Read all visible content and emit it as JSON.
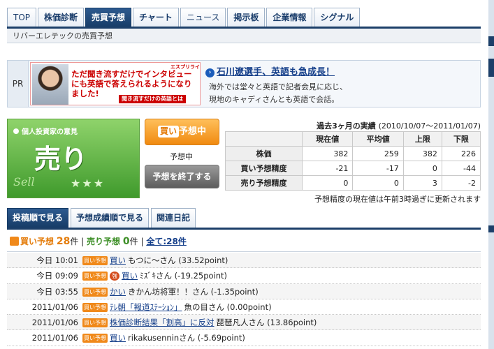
{
  "tabs": [
    {
      "label": "TOP"
    },
    {
      "label": "株価診断"
    },
    {
      "label": "売買予想"
    },
    {
      "label": "チャート"
    },
    {
      "label": "ニュース"
    },
    {
      "label": "掲示板"
    },
    {
      "label": "企業情報"
    },
    {
      "label": "シグナル"
    }
  ],
  "subtitle": "リバーエレテックの売買予想",
  "pr": {
    "label": "PR",
    "ad_brand": "エスプリライン",
    "ad_text": "ただ聞き流すだけでインタビューにも英語で答えられるようになりました!",
    "ad_button": "聞き流すだけの英語とは",
    "headline": "石川遼選手、英語も急成長！",
    "body_line1": "海外では堂々と英語で記者会見に応じ、",
    "body_line2": "現地のキャディさんとも英語で会話。"
  },
  "opinion": {
    "label": "個人投資家の意見",
    "value": "売り",
    "tag": "Sell",
    "stars": "★★★"
  },
  "buy_button": {
    "label": "買い",
    "suffix": "予想中"
  },
  "yoso_status": "予想中",
  "end_button": "予想を終了する",
  "stats": {
    "title": "過去3ヶ月の実績",
    "period": "(2010/10/07〜2011/01/07)",
    "headers": [
      "",
      "現在値",
      "平均値",
      "上限",
      "下限"
    ],
    "rows": [
      {
        "label": "株価",
        "values": [
          "382",
          "259",
          "382",
          "226"
        ]
      },
      {
        "label": "買い予想精度",
        "values": [
          "-21",
          "-17",
          "0",
          "-44"
        ]
      },
      {
        "label": "売り予想精度",
        "values": [
          "0",
          "0",
          "3",
          "-2"
        ]
      }
    ],
    "note": "予想精度の現在値は午前3時過ぎに更新されます"
  },
  "lower_tabs": [
    {
      "label": "投稿順で見る"
    },
    {
      "label": "予想成績順で見る"
    },
    {
      "label": "関連日記"
    }
  ],
  "counts": {
    "buy_label": "買い予想",
    "buy_count": "28",
    "sell_label": "売り予想",
    "sell_count": "0",
    "unit": "件",
    "separator": "|",
    "all_link": "全て:28件"
  },
  "posts": [
    {
      "date": "今日 10:01",
      "badge": "買い予想",
      "strong": "",
      "title": "買い",
      "author": "もつに〜さん (33.52point)"
    },
    {
      "date": "今日 09:09",
      "badge": "買い予想",
      "strong": "強",
      "title": "買い",
      "author": "ﾐｽﾞｷさん (-19.25point)"
    },
    {
      "date": "今日 03:55",
      "badge": "買い予想",
      "strong": "",
      "title": "かい",
      "author": "きかん坊将軍！！さん (-1.35point)"
    },
    {
      "date": "2011/01/06",
      "badge": "買い予想",
      "strong": "",
      "title": "ﾃﾚ朝「報道ｽﾃｰｼｮﾝ」",
      "author": "魚の目さん (0.00point)"
    },
    {
      "date": "2011/01/06",
      "badge": "買い予想",
      "strong": "",
      "title": "株価診断結果「割高」に反対",
      "author": "琵琶凡人さん (13.86point)"
    },
    {
      "date": "2011/01/06",
      "badge": "買い予想",
      "strong": "",
      "title": "買い",
      "author": "rikakusenninさん (-5.69point)"
    }
  ]
}
